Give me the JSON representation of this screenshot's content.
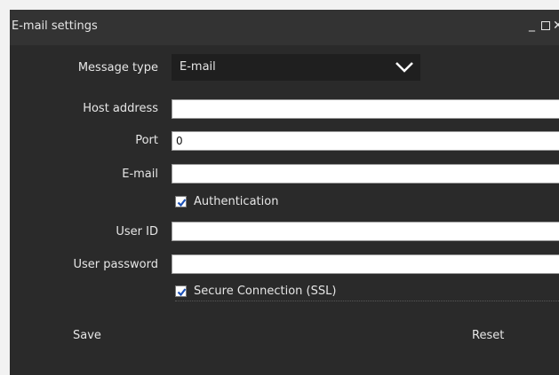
{
  "window": {
    "title": "E-mail settings",
    "minimize_glyph": "_",
    "close_glyph": "✕"
  },
  "form": {
    "message_type_label": "Message type",
    "message_type_value": "E-mail",
    "host_label": "Host address",
    "host_value": "",
    "port_label": "Port",
    "port_value": "0",
    "email_label": "E-mail",
    "email_value": "",
    "auth_label": "Authentication",
    "auth_checked": true,
    "userid_label": "User ID",
    "userid_value": "",
    "password_label": "User password",
    "password_value": "",
    "ssl_label": "Secure Connection (SSL)",
    "ssl_checked": true
  },
  "actions": {
    "save_label": "Save",
    "reset_label": "Reset"
  },
  "colors": {
    "window_bg": "#2a2a2a",
    "titlebar_bg": "#333333",
    "dropdown_bg": "#1f1f1f",
    "text": "#e6e6e6",
    "check_blue": "#1a4fb5"
  }
}
